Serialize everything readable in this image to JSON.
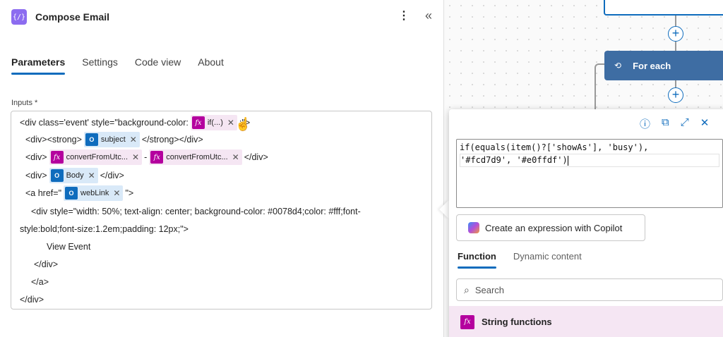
{
  "header": {
    "title": "Compose Email",
    "icon_glyph": "{/}",
    "more_glyph": "⋮",
    "collapse_glyph": "«"
  },
  "tabs": [
    {
      "label": "Parameters",
      "active": true
    },
    {
      "label": "Settings",
      "active": false
    },
    {
      "label": "Code view",
      "active": false
    },
    {
      "label": "About",
      "active": false
    }
  ],
  "inputs_label": "Inputs *",
  "editor": {
    "line1": {
      "pre": "<div class='event' style=\"background-color:",
      "token": "if(...)",
      "post": ";\">"
    },
    "line2": {
      "pre": "<div><strong>",
      "token": "subject",
      "post": "</strong></div>"
    },
    "line3": {
      "pre": "<div>",
      "token1": "convertFromUtc...",
      "mid": "-",
      "token2": "convertFromUtc...",
      "post": "</div>"
    },
    "line4": {
      "pre": "<div>",
      "token": "Body",
      "post": "</div>"
    },
    "line5": {
      "pre": "<a href=\"",
      "token": "webLink",
      "post": "\">"
    },
    "line6": "<div style=\"width: 50%; text-align: center; background-color: #0078d4;color: #fff;font-",
    "line7": "style:bold;font-size:1.2em;padding:    12px;\">",
    "line8": "View Event",
    "line9": "</div>",
    "line10": "</a>",
    "line11": "</div>"
  },
  "token_icons": {
    "fx": "fx",
    "outlook": "O"
  },
  "remove_glyph": "✕",
  "canvas": {
    "foreach_label": "For each",
    "foreach_icon": "⟲",
    "plus_glyph": "+"
  },
  "popup": {
    "icons": [
      "info-icon",
      "paste-icon",
      "expand-icon",
      "close-icon"
    ],
    "icon_glyphs": [
      "ⓘ",
      "⧉",
      "⤢",
      "✕"
    ],
    "expression_line1": "if(equals(item()?['showAs'], 'busy'),",
    "expression_line2": "'#fcd7d9', '#e0ffdf')",
    "copilot_label": "Create an expression with Copilot",
    "function_tabs": [
      {
        "label": "Function",
        "active": true
      },
      {
        "label": "Dynamic content",
        "active": false
      }
    ],
    "search_placeholder": "Search",
    "search_glyph": "⌕",
    "category_label": "String functions"
  },
  "colors": {
    "accent": "#0f6cbd",
    "fx_token": "#b4009e",
    "foreach_node": "#3e6da3",
    "compose_icon": "#8c6cf0"
  }
}
